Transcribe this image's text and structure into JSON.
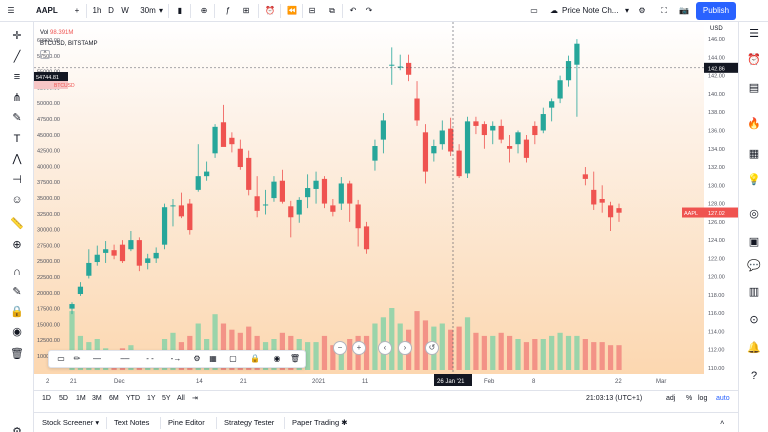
{
  "toolbar": {
    "symbol": "AAPL",
    "intervals": [
      "1h",
      "D",
      "W",
      "30m"
    ],
    "price_note": "Price Note Ch...",
    "publish": "Publish"
  },
  "legend": {
    "volume_label": "Vol",
    "volume_value": "98.391M",
    "compare_symbol": "BTCUSD, BITSTAMP"
  },
  "price_axis": {
    "currency": "USD",
    "labels": [
      "146.00",
      "144.00",
      "142.00",
      "140.00",
      "138.00",
      "136.00",
      "134.00",
      "132.00",
      "130.00",
      "128.00",
      "126.00",
      "124.00",
      "122.00",
      "120.00",
      "118.00",
      "116.00",
      "114.00",
      "112.00",
      "110.00"
    ],
    "current_badge": "142.86",
    "aapl_badge_label": "AAPL",
    "aapl_badge_value": "127.02"
  },
  "left_axis": {
    "labels": [
      "60000.00",
      "57500.00",
      "55000.00",
      "52500.00",
      "50000.00",
      "47500.00",
      "45000.00",
      "42500.00",
      "40000.00",
      "37500.00",
      "35000.00",
      "32500.00",
      "30000.00",
      "27500.00",
      "25000.00",
      "22500.00",
      "20000.00",
      "17500.00",
      "15000.00",
      "12500.00",
      "10000.00"
    ],
    "current_badge": "54744.81",
    "btc_badge": "BTCUSD"
  },
  "time_axis": {
    "labels": [
      "21",
      "Dec",
      "14",
      "21",
      "2021",
      "11",
      "Feb",
      "8",
      "22",
      "Mar"
    ],
    "crosshair_label": "26 Jan '21",
    "first_label": "2"
  },
  "range_bar": {
    "buttons": [
      "1D",
      "5D",
      "1M",
      "3M",
      "6M",
      "YTD",
      "1Y",
      "5Y",
      "All"
    ],
    "clock": "21:03:13 (UTC+1)",
    "adj": "adj",
    "pct": "%",
    "log": "log",
    "auto": "auto"
  },
  "bottom_tabs": [
    "Stock Screener",
    "Text Notes",
    "Pine Editor",
    "Strategy Tester",
    "Paper Trading"
  ],
  "colors": {
    "up": "#26a69a",
    "down": "#ef5350",
    "accent": "#2962ff"
  },
  "chart_data": {
    "type": "candlestick",
    "y_range": [
      110,
      147
    ],
    "candles": [
      {
        "o": 116.5,
        "h": 117.2,
        "l": 115.9,
        "c": 117.0
      },
      {
        "o": 118.1,
        "h": 119.4,
        "l": 117.9,
        "c": 118.9
      },
      {
        "o": 120.1,
        "h": 123.0,
        "l": 119.8,
        "c": 121.5
      },
      {
        "o": 121.6,
        "h": 123.4,
        "l": 121.2,
        "c": 122.4
      },
      {
        "o": 122.6,
        "h": 123.9,
        "l": 121.5,
        "c": 123.0
      },
      {
        "o": 122.9,
        "h": 123.5,
        "l": 121.9,
        "c": 122.3
      },
      {
        "o": 123.5,
        "h": 124.0,
        "l": 121.5,
        "c": 121.7
      },
      {
        "o": 123.0,
        "h": 125.0,
        "l": 122.8,
        "c": 124.0
      },
      {
        "o": 124.0,
        "h": 124.3,
        "l": 120.6,
        "c": 121.2
      },
      {
        "o": 121.5,
        "h": 122.5,
        "l": 120.8,
        "c": 122.0
      },
      {
        "o": 122.0,
        "h": 123.2,
        "l": 121.5,
        "c": 122.6
      },
      {
        "o": 123.5,
        "h": 128.0,
        "l": 123.0,
        "c": 127.6
      },
      {
        "o": 127.7,
        "h": 128.5,
        "l": 125.5,
        "c": 127.8
      },
      {
        "o": 127.8,
        "h": 129.2,
        "l": 126.4,
        "c": 126.6
      },
      {
        "o": 128.0,
        "h": 128.5,
        "l": 124.6,
        "c": 125.1
      },
      {
        "o": 129.5,
        "h": 134.5,
        "l": 129.3,
        "c": 131.0
      },
      {
        "o": 131.0,
        "h": 132.6,
        "l": 130.5,
        "c": 131.5
      },
      {
        "o": 133.5,
        "h": 136.7,
        "l": 133.0,
        "c": 136.4
      },
      {
        "o": 136.9,
        "h": 138.8,
        "l": 134.8,
        "c": 134.2
      },
      {
        "o": 135.2,
        "h": 135.8,
        "l": 133.6,
        "c": 134.5
      },
      {
        "o": 134.0,
        "h": 135.0,
        "l": 131.7,
        "c": 132.0
      },
      {
        "o": 133.0,
        "h": 133.8,
        "l": 128.9,
        "c": 129.5
      },
      {
        "o": 128.8,
        "h": 131.0,
        "l": 126.5,
        "c": 127.2
      },
      {
        "o": 127.8,
        "h": 129.5,
        "l": 126.8,
        "c": 127.9
      },
      {
        "o": 128.6,
        "h": 131.0,
        "l": 128.2,
        "c": 130.4
      },
      {
        "o": 130.5,
        "h": 131.7,
        "l": 128.0,
        "c": 128.2
      },
      {
        "o": 127.7,
        "h": 128.3,
        "l": 124.3,
        "c": 126.5
      },
      {
        "o": 126.8,
        "h": 128.7,
        "l": 125.9,
        "c": 128.4
      },
      {
        "o": 128.7,
        "h": 131.2,
        "l": 127.5,
        "c": 129.7
      },
      {
        "o": 129.6,
        "h": 131.5,
        "l": 128.0,
        "c": 130.5
      },
      {
        "o": 130.7,
        "h": 131.0,
        "l": 127.5,
        "c": 128.0
      },
      {
        "o": 127.8,
        "h": 128.5,
        "l": 126.6,
        "c": 127.1
      },
      {
        "o": 128.0,
        "h": 130.9,
        "l": 127.3,
        "c": 130.2
      },
      {
        "o": 130.2,
        "h": 130.5,
        "l": 126.0,
        "c": 128.0
      },
      {
        "o": 127.9,
        "h": 128.4,
        "l": 123.3,
        "c": 125.3
      },
      {
        "o": 125.5,
        "h": 126.0,
        "l": 122.5,
        "c": 123.0
      },
      {
        "o": 132.7,
        "h": 135.0,
        "l": 131.6,
        "c": 134.3
      },
      {
        "o": 135.0,
        "h": 137.9,
        "l": 133.5,
        "c": 137.1
      },
      {
        "o": 143.1,
        "h": 145.1,
        "l": 141.0,
        "c": 143.2
      },
      {
        "o": 143.0,
        "h": 144.3,
        "l": 142.6,
        "c": 143.0
      },
      {
        "o": 143.4,
        "h": 144.3,
        "l": 141.4,
        "c": 142.1
      },
      {
        "o": 139.5,
        "h": 141.4,
        "l": 136.5,
        "c": 137.1
      },
      {
        "o": 135.8,
        "h": 136.7,
        "l": 130.2,
        "c": 131.5
      },
      {
        "o": 133.5,
        "h": 135.0,
        "l": 132.6,
        "c": 134.3
      },
      {
        "o": 134.5,
        "h": 137.1,
        "l": 133.9,
        "c": 136.0
      },
      {
        "o": 136.2,
        "h": 137.4,
        "l": 133.2,
        "c": 133.7
      },
      {
        "o": 133.8,
        "h": 134.5,
        "l": 130.8,
        "c": 131.0
      },
      {
        "o": 131.3,
        "h": 137.5,
        "l": 130.8,
        "c": 137.0
      },
      {
        "o": 137.0,
        "h": 137.5,
        "l": 135.6,
        "c": 136.5
      },
      {
        "o": 136.7,
        "h": 137.0,
        "l": 134.0,
        "c": 135.5
      },
      {
        "o": 136.0,
        "h": 137.0,
        "l": 134.5,
        "c": 136.5
      },
      {
        "o": 136.5,
        "h": 137.2,
        "l": 134.6,
        "c": 135.0
      },
      {
        "o": 134.3,
        "h": 135.5,
        "l": 132.5,
        "c": 134.0
      },
      {
        "o": 134.5,
        "h": 136.0,
        "l": 133.5,
        "c": 135.8
      },
      {
        "o": 135.0,
        "h": 135.5,
        "l": 132.5,
        "c": 133.0
      },
      {
        "o": 136.5,
        "h": 137.0,
        "l": 134.5,
        "c": 135.5
      },
      {
        "o": 136.0,
        "h": 138.5,
        "l": 135.7,
        "c": 137.8
      },
      {
        "o": 138.5,
        "h": 139.5,
        "l": 137.0,
        "c": 139.2
      },
      {
        "o": 139.5,
        "h": 142.0,
        "l": 139.0,
        "c": 141.5
      },
      {
        "o": 141.5,
        "h": 144.2,
        "l": 140.8,
        "c": 143.6
      },
      {
        "o": 143.2,
        "h": 146.0,
        "l": 137.5,
        "c": 145.5
      },
      {
        "o": 131.2,
        "h": 132.0,
        "l": 130.0,
        "c": 130.7
      },
      {
        "o": 129.5,
        "h": 131.5,
        "l": 127.3,
        "c": 127.9
      },
      {
        "o": 128.5,
        "h": 130.0,
        "l": 127.0,
        "c": 128.1
      },
      {
        "o": 127.8,
        "h": 128.2,
        "l": 125.0,
        "c": 126.5
      },
      {
        "o": 127.5,
        "h": 128.0,
        "l": 126.0,
        "c": 127.0
      }
    ],
    "volumes": [
      0.95,
      0.55,
      0.45,
      0.5,
      0.35,
      0.3,
      0.35,
      0.4,
      0.3,
      0.25,
      0.3,
      0.5,
      0.6,
      0.45,
      0.55,
      0.75,
      0.5,
      0.9,
      0.75,
      0.65,
      0.6,
      0.7,
      0.55,
      0.45,
      0.5,
      0.6,
      0.55,
      0.5,
      0.45,
      0.45,
      0.55,
      0.4,
      0.45,
      0.5,
      0.55,
      0.55,
      0.75,
      0.85,
      1.0,
      0.75,
      0.65,
      0.95,
      0.8,
      0.7,
      0.75,
      0.65,
      0.7,
      0.85,
      0.6,
      0.55,
      0.55,
      0.6,
      0.55,
      0.5,
      0.45,
      0.5,
      0.5,
      0.55,
      0.6,
      0.55,
      0.55,
      0.5,
      0.45,
      0.45,
      0.4,
      0.4
    ]
  }
}
